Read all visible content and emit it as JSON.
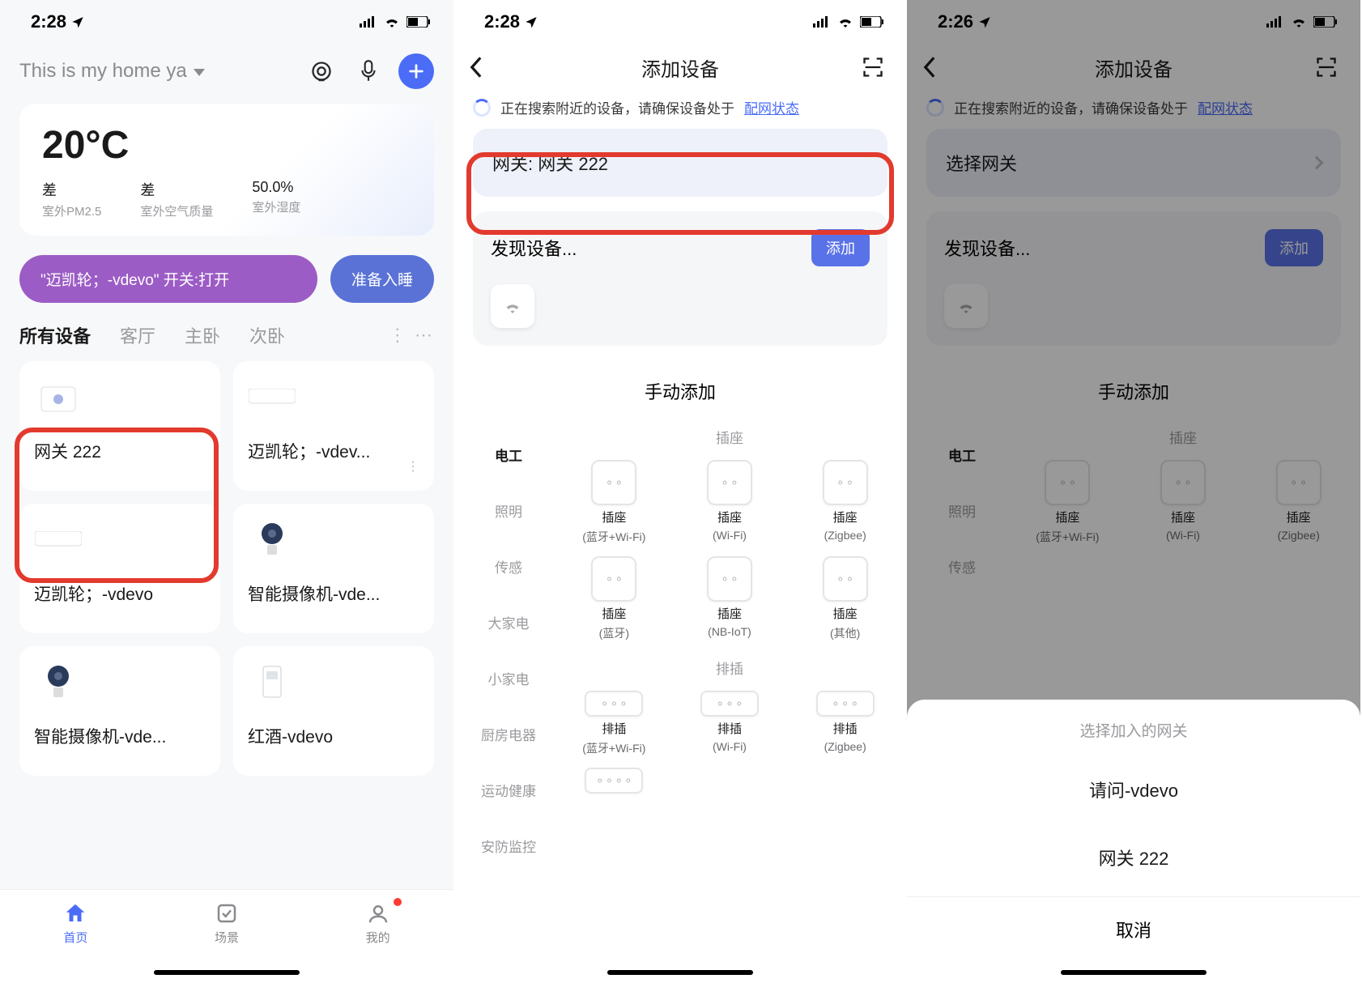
{
  "statusbar": {
    "time1": "2:28",
    "time2": "2:28",
    "time3": "2:26"
  },
  "s1": {
    "home_title": "This is my home ya",
    "temp": "20°C",
    "weather": [
      {
        "v": "差",
        "l": "室外PM2.5"
      },
      {
        "v": "差",
        "l": "室外空气质量"
      },
      {
        "v": "50.0%",
        "l": "室外湿度"
      }
    ],
    "pill_purple": "\"迈凯轮；-vdevo\" 开关:打开",
    "pill_blue": "准备入睡",
    "room_tabs": [
      "所有设备",
      "客厅",
      "主卧",
      "次卧"
    ],
    "devices": [
      "网关 222",
      "迈凯轮；-vdev...",
      "迈凯轮；-vdevo",
      "智能摄像机-vde...",
      "智能摄像机-vde...",
      "红酒-vdevo"
    ],
    "tabbar": [
      "首页",
      "场景",
      "我的"
    ]
  },
  "s2": {
    "title": "添加设备",
    "tip_a": "正在搜索附近的设备，请确保设备处于",
    "tip_link": "配网状态",
    "gateway": "网关: 网关 222",
    "found": "发现设备...",
    "add": "添加",
    "manual": "手动添加",
    "cat_head": "电工",
    "cats": [
      "照明",
      "传感",
      "大家电",
      "小家电",
      "厨房电器",
      "运动健康",
      "安防监控"
    ],
    "sec1": "插座",
    "sockets": [
      {
        "n": "插座",
        "s": "(蓝牙+Wi-Fi)"
      },
      {
        "n": "插座",
        "s": "(Wi-Fi)"
      },
      {
        "n": "插座",
        "s": "(Zigbee)"
      },
      {
        "n": "插座",
        "s": "(蓝牙)"
      },
      {
        "n": "插座",
        "s": "(NB-IoT)"
      },
      {
        "n": "插座",
        "s": "(其他)"
      }
    ],
    "sec2": "排插",
    "strips": [
      {
        "n": "排插",
        "s": "(蓝牙+Wi-Fi)"
      },
      {
        "n": "排插",
        "s": "(Wi-Fi)"
      },
      {
        "n": "排插",
        "s": "(Zigbee)"
      }
    ]
  },
  "s3": {
    "title": "添加设备",
    "tip_a": "正在搜索附近的设备，请确保设备处于",
    "tip_link": "配网状态",
    "gateway": "选择网关",
    "found": "发现设备...",
    "add": "添加",
    "manual": "手动添加",
    "cat_head": "电工",
    "cats": [
      "照明",
      "传感"
    ],
    "sec1": "插座",
    "sockets": [
      {
        "n": "插座",
        "s": "(蓝牙+Wi-Fi)"
      },
      {
        "n": "插座",
        "s": "(Wi-Fi)"
      },
      {
        "n": "插座",
        "s": "(Zigbee)"
      }
    ],
    "sheet_title": "选择加入的网关",
    "sheet_opts": [
      "请问-vdevo",
      "网关 222"
    ],
    "sheet_cancel": "取消"
  }
}
